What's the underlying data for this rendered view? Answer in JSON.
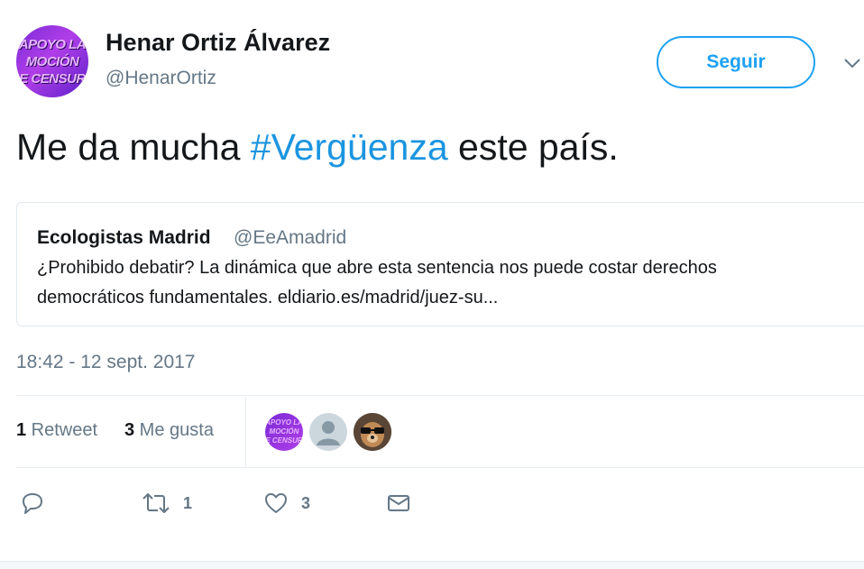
{
  "author": {
    "avatar_text": [
      "APOYO LA",
      "MOCIÓN",
      "DE CENSURA"
    ],
    "name": "Henar Ortiz Álvarez",
    "handle": "@HenarOrtiz"
  },
  "follow_button": "Seguir",
  "tweet": {
    "text_before": "Me da mucha ",
    "hashtag": "#Vergüenza",
    "text_after": " este país."
  },
  "quoted_tweet": {
    "name": "Ecologistas Madrid",
    "handle": "@EeAmadrid",
    "line1": "¿Prohibido debatir? La dinámica que abre esta sentencia nos puede costar derechos",
    "line2": "democráticos fundamentales. eldiario.es/madrid/juez-su..."
  },
  "timestamp": "18:42 - 12 sept. 2017",
  "stats": {
    "retweets_count": "1",
    "retweets_label": " Retweet",
    "likes_count": "3",
    "likes_label": " Me gusta"
  },
  "actions": {
    "reply_count": "",
    "retweet_count": "1",
    "like_count": "3"
  },
  "colors": {
    "accent": "#1da1f2",
    "hashtag": "#1b95e0",
    "secondary_text": "#657786",
    "avatar_purple": "#7a2bd6"
  },
  "icons": [
    "reply-icon",
    "retweet-icon",
    "heart-icon",
    "envelope-icon",
    "chevron-down-icon"
  ]
}
